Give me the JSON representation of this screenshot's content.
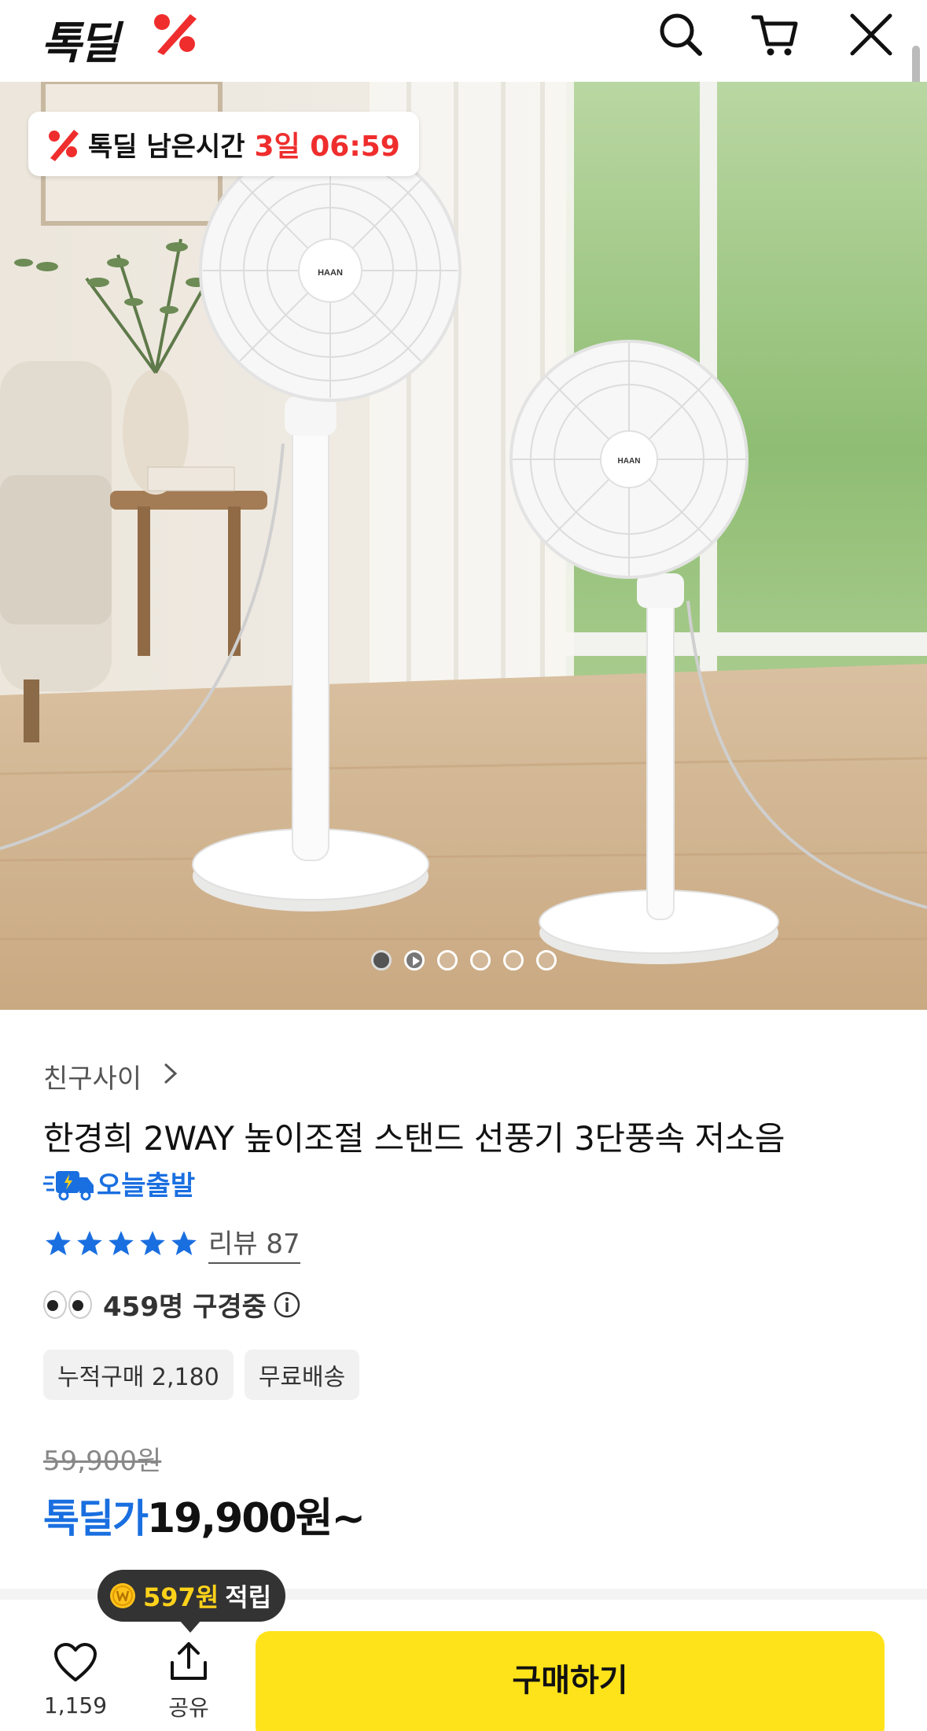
{
  "header": {
    "logo_text": "톡딜",
    "logo_mark_color": "#ef2d2d",
    "icons": [
      "search-icon",
      "cart-icon",
      "close-icon"
    ]
  },
  "hero": {
    "timer": {
      "label": "톡딜 남은시간",
      "value": "3일 06:59",
      "value_color": "#ef2d2d"
    },
    "brand_text": "HAAN",
    "carousel": {
      "total": 6,
      "active_index": 0,
      "video_index": 1
    }
  },
  "product": {
    "seller": "친구사이",
    "title": "한경희 2WAY 높이조절 스탠드 선풍기 3단풍속 저소음",
    "delivery_badge": "오늘출발",
    "rating_stars": 5,
    "review_label": "리뷰 87",
    "viewers": "459명 구경중",
    "chips": [
      "누적구매 2,180",
      "무료배송"
    ],
    "original_price": "59,900원",
    "deal_label": "톡딜가",
    "deal_price": "19,900원~",
    "accent_color": "#1a6fe0"
  },
  "bottom_bar": {
    "like_count": "1,159",
    "share_label": "공유",
    "buy_label": "구매하기",
    "buy_color": "#ffe31a",
    "points_amount": "597원",
    "points_suffix": "적립"
  }
}
